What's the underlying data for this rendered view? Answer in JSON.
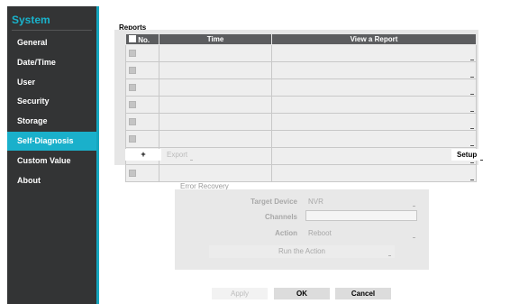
{
  "sidebar": {
    "title": "System",
    "items": [
      {
        "label": "General",
        "active": false
      },
      {
        "label": "Date/Time",
        "active": false
      },
      {
        "label": "User",
        "active": false
      },
      {
        "label": "Security",
        "active": false
      },
      {
        "label": "Storage",
        "active": false
      },
      {
        "label": "Self-Diagnosis",
        "active": true
      },
      {
        "label": "Custom Value",
        "active": false
      },
      {
        "label": "About",
        "active": false
      }
    ],
    "accent_color": "#1ab0cb"
  },
  "reports": {
    "label": "Reports",
    "columns": [
      "No.",
      "Time",
      "View a Report"
    ],
    "row_count": 8,
    "add_label": "+",
    "export_label": "Export",
    "setup_label": "Setup"
  },
  "error_recovery": {
    "label": "Error Recovery",
    "target_device_label": "Target Device",
    "target_device_value": "NVR",
    "channels_label": "Channels",
    "channels_value": "",
    "action_label": "Action",
    "action_value": "Reboot",
    "run_label": "Run the Action"
  },
  "footer": {
    "apply_label": "Apply",
    "ok_label": "OK",
    "cancel_label": "Cancel"
  }
}
